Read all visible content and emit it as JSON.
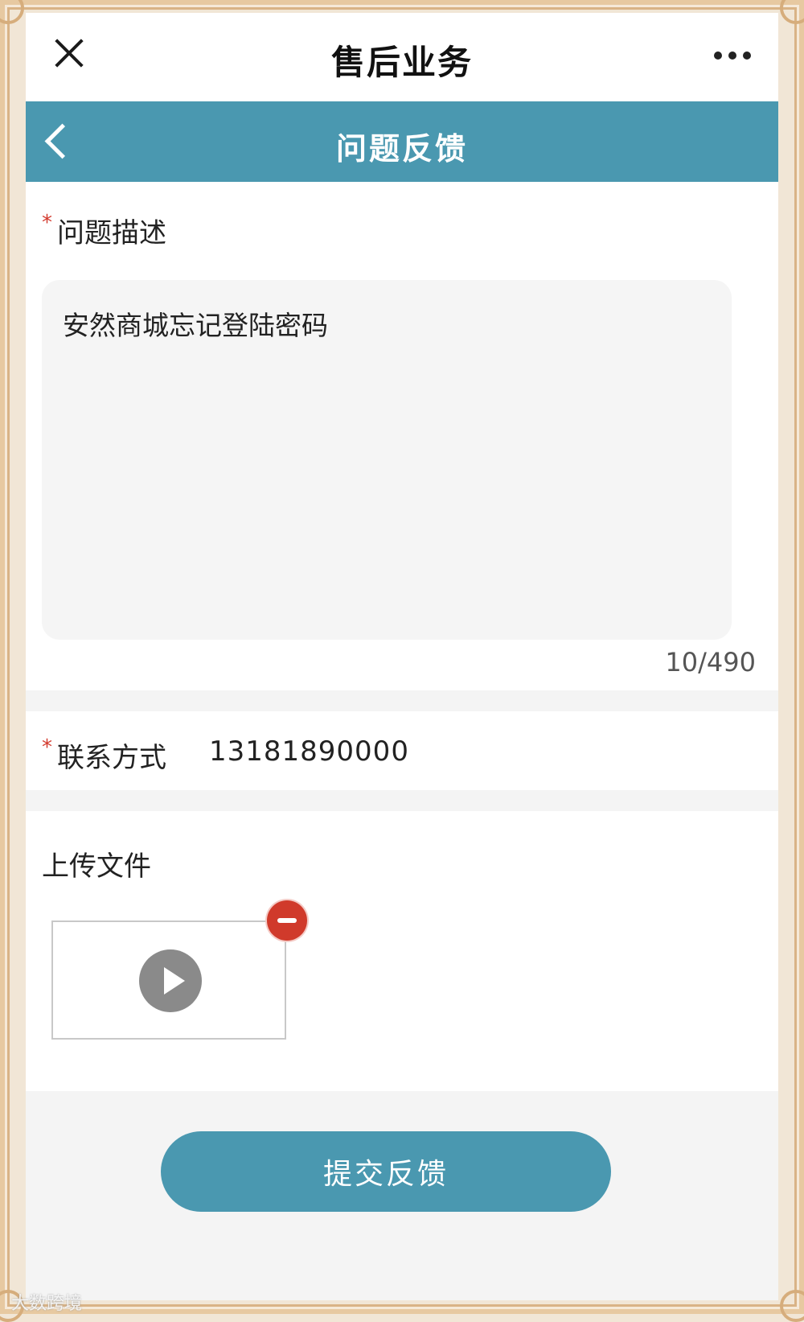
{
  "topbar": {
    "title": "售后业务",
    "close_icon": "close-icon",
    "more_icon": "more-dots-icon"
  },
  "nav": {
    "title": "问题反馈",
    "back_icon": "chevron-left-icon"
  },
  "form": {
    "required_mark": "*",
    "description_label": "问题描述",
    "description_value": "安然商城忘记登陆密码",
    "char_counter": "10/490",
    "contact_label": "联系方式",
    "contact_value": "13181890000",
    "upload_label": "上传文件"
  },
  "submit_label": "提交反馈",
  "watermark": "大数跨境",
  "colors": {
    "accent": "#4a98b0",
    "required": "#d33b2f",
    "remove": "#d03a2b"
  }
}
